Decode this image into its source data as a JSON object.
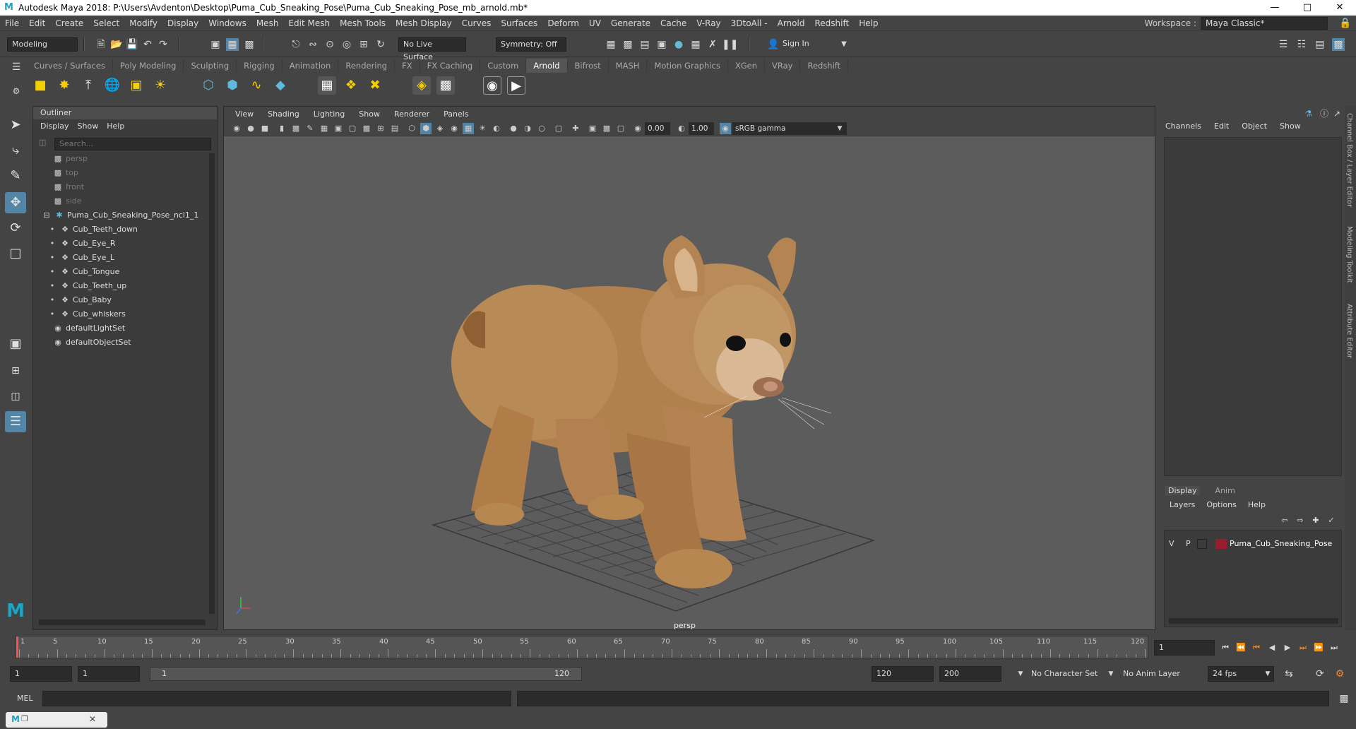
{
  "window": {
    "title": "Autodesk Maya 2018: P:\\Users\\Avdenton\\Desktop\\Puma_Cub_Sneaking_Pose\\Puma_Cub_Sneaking_Pose_mb_arnold.mb*"
  },
  "menubar": {
    "items": [
      "File",
      "Edit",
      "Create",
      "Select",
      "Modify",
      "Display",
      "Windows",
      "Mesh",
      "Edit Mesh",
      "Mesh Tools",
      "Mesh Display",
      "Curves",
      "Surfaces",
      "Deform",
      "UV",
      "Generate",
      "Cache",
      "V-Ray",
      "3DtoAll -",
      "Arnold",
      "Redshift",
      "Help"
    ],
    "workspace_label": "Workspace :",
    "workspace_value": "Maya Classic*"
  },
  "statusline": {
    "mode": "Modeling",
    "live_surface": "No Live Surface",
    "symmetry": "Symmetry: Off",
    "sign_in": "Sign In"
  },
  "shelf": {
    "tabs": [
      "Curves / Surfaces",
      "Poly Modeling",
      "Sculpting",
      "Rigging",
      "Animation",
      "Rendering",
      "FX",
      "FX Caching",
      "Custom",
      "Arnold",
      "Bifrost",
      "MASH",
      "Motion Graphics",
      "XGen",
      "VRay",
      "Redshift"
    ],
    "active_tab": "Arnold"
  },
  "outliner": {
    "title": "Outliner",
    "menu": [
      "Display",
      "Show",
      "Help"
    ],
    "search_placeholder": "Search...",
    "cameras": [
      "persp",
      "top",
      "front",
      "side"
    ],
    "root": "Puma_Cub_Sneaking_Pose_ncl1_1",
    "children": [
      "Cub_Teeth_down",
      "Cub_Eye_R",
      "Cub_Eye_L",
      "Cub_Tongue",
      "Cub_Teeth_up",
      "Cub_Baby",
      "Cub_whiskers"
    ],
    "sets": [
      "defaultLightSet",
      "defaultObjectSet"
    ]
  },
  "viewport": {
    "menu": [
      "View",
      "Shading",
      "Lighting",
      "Show",
      "Renderer",
      "Panels"
    ],
    "exposure": "0.00",
    "gamma": "1.00",
    "color_space": "sRGB gamma",
    "camera_label": "persp"
  },
  "channelbox": {
    "menu": [
      "Channels",
      "Edit",
      "Object",
      "Show"
    ],
    "layer_tabs": [
      "Display",
      "Anim"
    ],
    "layer_menu": [
      "Layers",
      "Options",
      "Help"
    ],
    "layer": {
      "v": "V",
      "p": "P",
      "name": "Puma_Cub_Sneaking_Pose",
      "color": "#9b1b30"
    }
  },
  "sidetabs": [
    "Channel Box / Layer Editor",
    "Modeling Toolkit",
    "Attribute Editor"
  ],
  "timeline": {
    "ticks": [
      "1",
      "5",
      "10",
      "15",
      "20",
      "25",
      "30",
      "35",
      "40",
      "45",
      "50",
      "55",
      "60",
      "65",
      "70",
      "75",
      "80",
      "85",
      "90",
      "95",
      "100",
      "105",
      "110",
      "115",
      "120"
    ],
    "current_frame": "1"
  },
  "range": {
    "start": "1",
    "playback_start": "1",
    "slider_start": "1",
    "slider_end": "120",
    "playback_end": "120",
    "end": "200",
    "character_set": "No Character Set",
    "anim_layer": "No Anim Layer",
    "fps": "24 fps"
  },
  "cmdline": {
    "label": "MEL"
  },
  "colors": {
    "accent": "#5285a6",
    "viewport_bg": "#5c5c5c",
    "panel": "#444444"
  }
}
